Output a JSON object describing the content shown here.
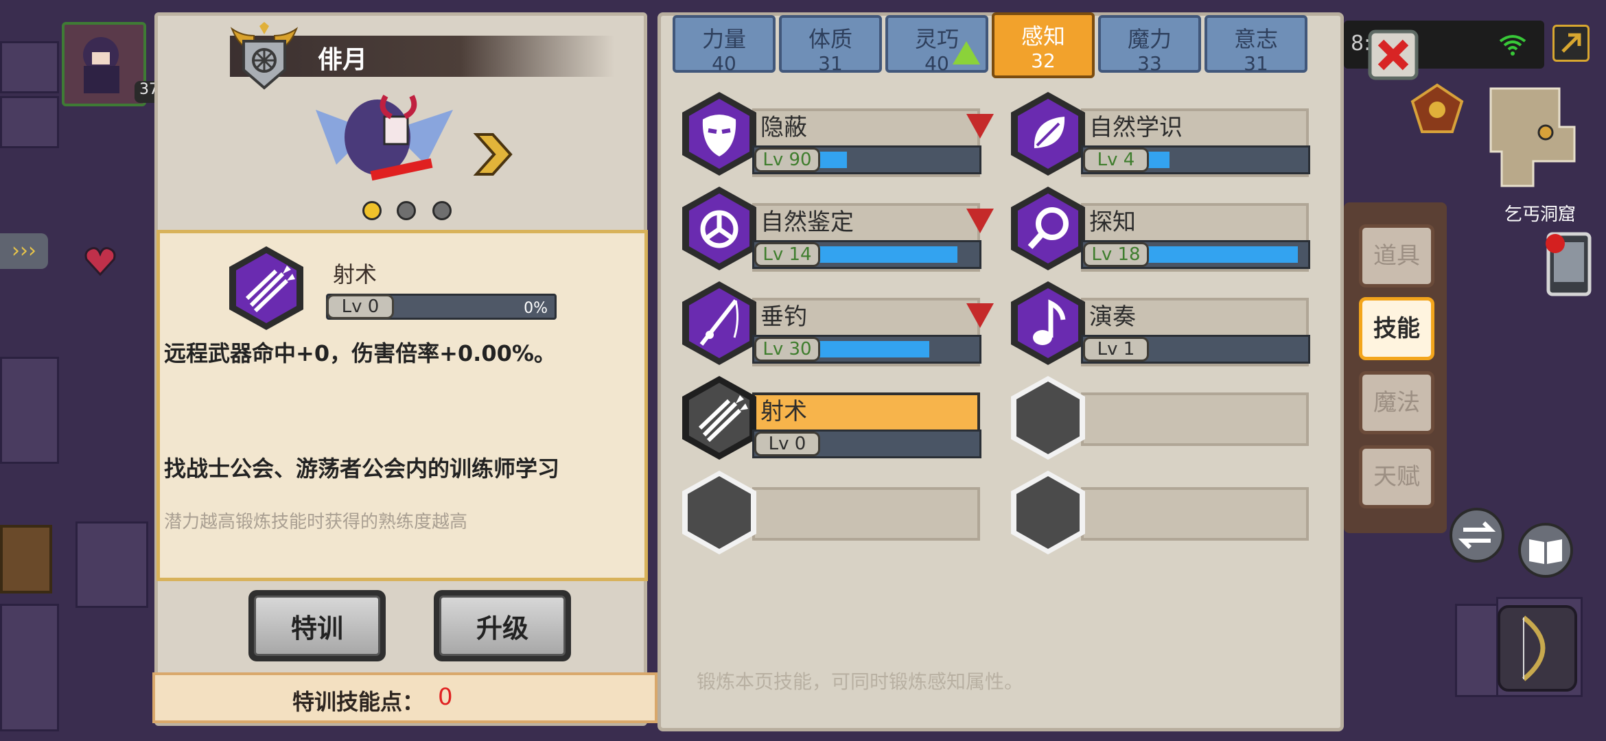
{
  "character": {
    "name": "俳月",
    "level_badge": "37",
    "carousel_index": 0,
    "carousel_count": 3
  },
  "attribute_tabs": [
    {
      "name": "力量",
      "value": "40",
      "active": false,
      "arrow": null
    },
    {
      "name": "体质",
      "value": "31",
      "active": false,
      "arrow": null
    },
    {
      "name": "灵巧",
      "value": "40",
      "active": false,
      "arrow": "up"
    },
    {
      "name": "感知",
      "value": "32",
      "active": true,
      "arrow": null
    },
    {
      "name": "魔力",
      "value": "33",
      "active": false,
      "arrow": null
    },
    {
      "name": "意志",
      "value": "31",
      "active": false,
      "arrow": null
    }
  ],
  "selected_skill": {
    "name": "射术",
    "level": "Lv 0",
    "progress_text": "0%",
    "progress": 0,
    "description": "远程武器命中+0，伤害倍率+0.00%。",
    "learn_hint": "找战士公会、游荡者公会内的训练师学习",
    "note": "潜力越高锻炼技能时获得的熟练度越高"
  },
  "buttons": {
    "train": "特训",
    "upgrade": "升级"
  },
  "training_points": {
    "label": "特训技能点：",
    "value": "0"
  },
  "skills": [
    {
      "name": "隐蔽",
      "level": "Lv 90",
      "progress": 0.18,
      "down": true,
      "icon": "mask-icon"
    },
    {
      "name": "自然学识",
      "level": "Lv 4",
      "progress": 0.14,
      "down": false,
      "icon": "leaf-icon"
    },
    {
      "name": "自然鉴定",
      "level": "Lv 14",
      "progress": 0.88,
      "down": true,
      "icon": "triskelion-icon"
    },
    {
      "name": "探知",
      "level": "Lv 18",
      "progress": 0.95,
      "down": false,
      "icon": "magnifier-icon"
    },
    {
      "name": "垂钓",
      "level": "Lv 30",
      "progress": 0.7,
      "down": true,
      "icon": "fishing-rod-icon"
    },
    {
      "name": "演奏",
      "level": "Lv 1",
      "progress": 0.0,
      "down": false,
      "icon": "music-note-icon"
    },
    {
      "name": "射术",
      "level": "Lv 0",
      "progress": 0.0,
      "down": false,
      "icon": "arrows-icon",
      "selected": true
    }
  ],
  "footer_hint": "锻炼本页技能，可同时锻炼感知属性。",
  "side_tabs": [
    {
      "label": "道具",
      "active": false
    },
    {
      "label": "技能",
      "active": true
    },
    {
      "label": "魔法",
      "active": false
    },
    {
      "label": "天赋",
      "active": false
    }
  ],
  "hud": {
    "location": "乞丐洞窟",
    "clock_fragment": "8:"
  },
  "colors": {
    "accent_orange": "#f2a22c",
    "bar_blue": "#33a3f0",
    "down_red": "#c52a2a",
    "up_green": "#8bd23a",
    "icon_purple": "#6a2bb0"
  }
}
